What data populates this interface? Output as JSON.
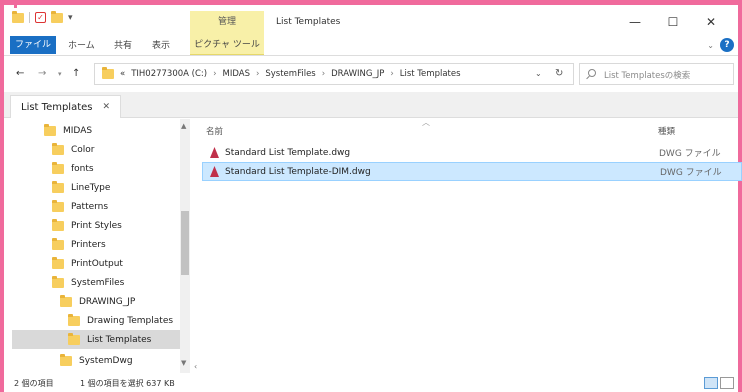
{
  "titlebar": {
    "title": "List Templates",
    "manage_tab": "管理",
    "minimize": "—",
    "maximize": "☐",
    "close": "✕"
  },
  "ribbon": {
    "file": "ファイル",
    "home": "ホーム",
    "share": "共有",
    "view": "表示",
    "picture_tools": "ピクチャ ツール",
    "help": "?"
  },
  "address": {
    "overflow": "«",
    "crumbs": [
      "TIH0277300A (C:)",
      "MIDAS",
      "SystemFiles",
      "DRAWING_JP",
      "List Templates"
    ],
    "search_placeholder": "List Templatesの検索"
  },
  "tab": {
    "label": "List Templates",
    "close": "✕"
  },
  "tree": [
    {
      "label": "MIDAS"
    },
    {
      "label": "Color"
    },
    {
      "label": "fonts"
    },
    {
      "label": "LineType"
    },
    {
      "label": "Patterns"
    },
    {
      "label": "Print Styles"
    },
    {
      "label": "Printers"
    },
    {
      "label": "PrintOutput"
    },
    {
      "label": "SystemFiles"
    },
    {
      "label": "DRAWING_JP"
    },
    {
      "label": "Drawing Templates"
    },
    {
      "label": "List Templates"
    },
    {
      "label": "SystemDwg"
    }
  ],
  "columns": {
    "name": "名前",
    "type": "種類"
  },
  "files": [
    {
      "name": "Standard List Template.dwg",
      "type": "DWG ファイル"
    },
    {
      "name": "Standard List Template-DIM.dwg",
      "type": "DWG ファイル"
    }
  ],
  "status": {
    "items": "2 個の項目",
    "selection": "1 個の項目を選択  637 KB"
  },
  "colors": {
    "frame": "#f06a9c",
    "accent": "#1a6fc4",
    "tools_tab": "#f8f0a8",
    "selection": "#cce8ff"
  }
}
